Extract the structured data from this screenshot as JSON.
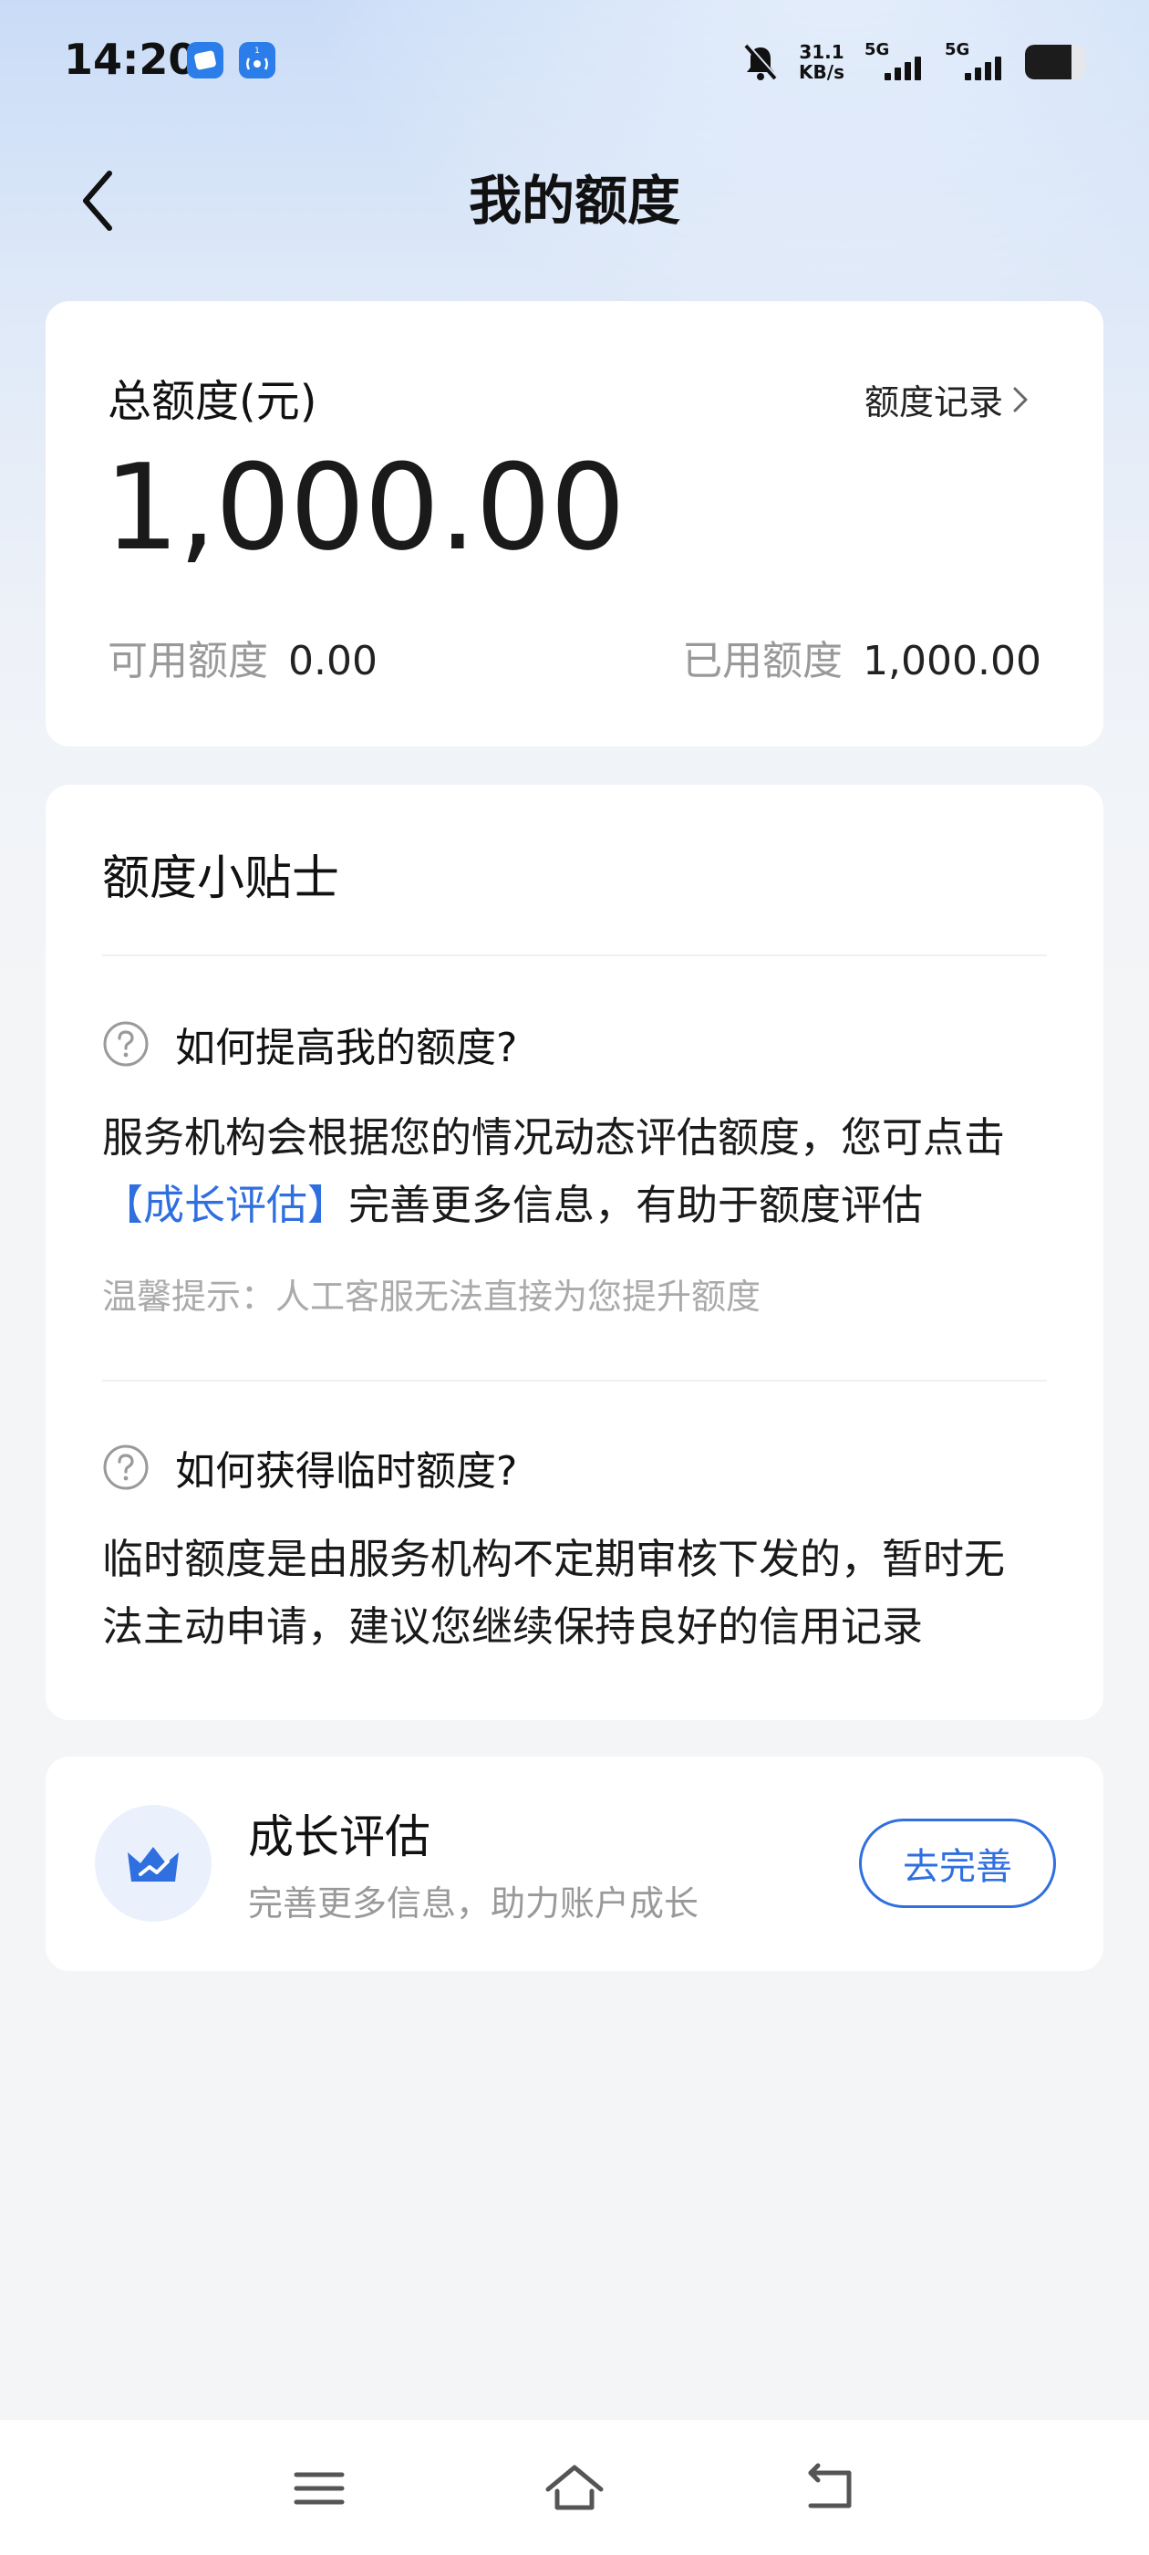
{
  "status_bar": {
    "time": "14:20",
    "net_speed_value": "31.1",
    "net_speed_unit": "KB/s",
    "sim1_label": "5G",
    "sim2_label": "5G"
  },
  "header": {
    "title": "我的额度"
  },
  "quota": {
    "title": "总额度(元)",
    "record_link": "额度记录",
    "total": "1,000.00",
    "available_label": "可用额度",
    "available_value": "0.00",
    "used_label": "已用额度",
    "used_value": "1,000.00"
  },
  "tips": {
    "title": "额度小贴士",
    "q1": {
      "question": "如何提高我的额度?",
      "answer_part1": "服务机构会根据您的情况动态评估额度，您可点击",
      "answer_link": "【成长评估】",
      "answer_part2": "完善更多信息，有助于额度评估",
      "note": "温馨提示：人工客服无法直接为您提升额度"
    },
    "q2": {
      "question": "如何获得临时额度?",
      "answer_line1": "临时额度是由服务机构不定期审核下发的，暂时无",
      "answer_line2": "法主动申请，建议您继续保持良好的信用记录"
    }
  },
  "growth": {
    "title": "成长评估",
    "subtitle": "完善更多信息，助力账户成长",
    "button": "去完善"
  },
  "colors": {
    "accent": "#2f6fdf",
    "muted": "#999999",
    "page_bg": "#f4f5f7"
  },
  "icons": {
    "back": "chevron-left-icon",
    "record_arrow": "chevron-right-icon",
    "question": "question-circle-icon",
    "growth": "crown-trend-icon",
    "nav_menu": "menu-icon",
    "nav_home": "home-icon",
    "nav_back": "return-icon"
  }
}
